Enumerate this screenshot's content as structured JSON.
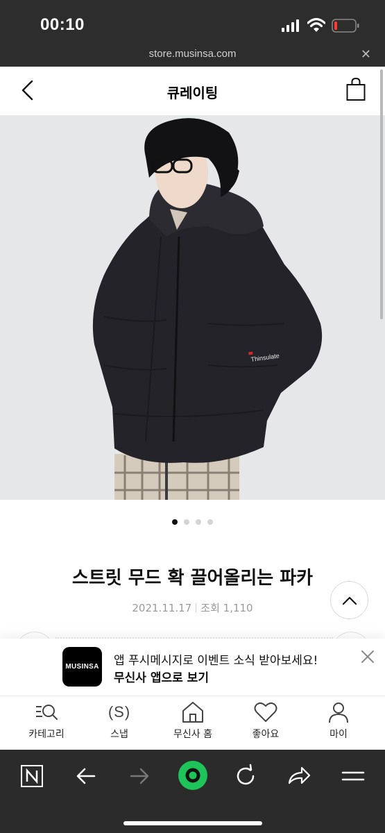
{
  "status_bar": {
    "time": "00:10"
  },
  "url_bar": {
    "url": "store.musinsa.com"
  },
  "header": {
    "title": "큐레이팅"
  },
  "product": {
    "image_label": "Thinsulate",
    "carousel": {
      "total": 4,
      "active": 1
    }
  },
  "article": {
    "title": "스트릿 무드 확 끌어올리는 파카",
    "date": "2021.11.17",
    "views_label": "조회",
    "views": "1,110"
  },
  "app_banner": {
    "logo_text": "MUSINSA",
    "message": "앱 푸시메시지로 이벤트 소식 받아보세요!",
    "cta": "무신사 앱으로 보기"
  },
  "tab_bar": {
    "items": [
      {
        "label": "카테고리",
        "icon": "category-search-icon"
      },
      {
        "label": "스냅",
        "icon": "snap-icon",
        "glyph": "(S)"
      },
      {
        "label": "무신사 홈",
        "icon": "home-icon"
      },
      {
        "label": "좋아요",
        "icon": "heart-icon"
      },
      {
        "label": "마이",
        "icon": "person-icon"
      }
    ]
  },
  "browser_toolbar": {
    "items": [
      "naver-icon",
      "back-arrow-icon",
      "forward-arrow-icon",
      "green-home-icon",
      "refresh-icon",
      "share-icon",
      "menu-icon"
    ]
  },
  "colors": {
    "accent_green": "#1ec35a",
    "dark_bar": "#2b2b2b"
  }
}
